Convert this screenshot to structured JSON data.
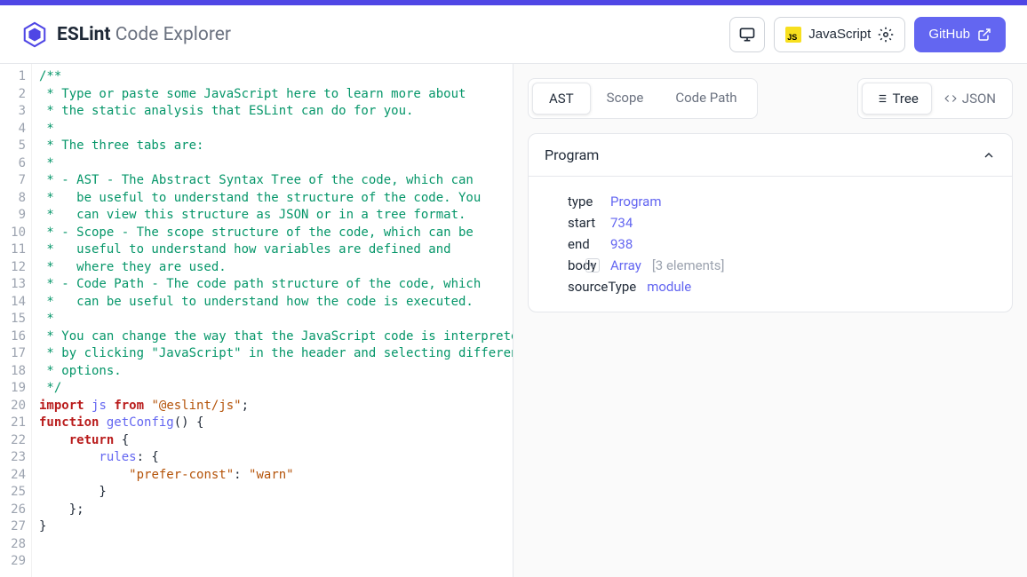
{
  "header": {
    "brand_bold": "ESLint",
    "brand_light": "Code Explorer",
    "language_label": "JavaScript",
    "github_label": "GitHub"
  },
  "editor": {
    "lines": [
      {
        "n": 1,
        "tokens": [
          {
            "t": "/**",
            "c": "c-comment"
          }
        ]
      },
      {
        "n": 2,
        "tokens": [
          {
            "t": " * Type or paste some JavaScript here to learn more about",
            "c": "c-comment"
          }
        ]
      },
      {
        "n": 3,
        "tokens": [
          {
            "t": " * the static analysis that ESLint can do for you.",
            "c": "c-comment"
          }
        ]
      },
      {
        "n": 4,
        "tokens": [
          {
            "t": " *",
            "c": "c-comment"
          }
        ]
      },
      {
        "n": 5,
        "tokens": [
          {
            "t": " * The three tabs are:",
            "c": "c-comment"
          }
        ]
      },
      {
        "n": 6,
        "tokens": [
          {
            "t": " *",
            "c": "c-comment"
          }
        ]
      },
      {
        "n": 7,
        "tokens": [
          {
            "t": " * - AST - The Abstract Syntax Tree of the code, which can",
            "c": "c-comment"
          }
        ]
      },
      {
        "n": 8,
        "tokens": [
          {
            "t": " *   be useful to understand the structure of the code. You",
            "c": "c-comment"
          }
        ]
      },
      {
        "n": 9,
        "tokens": [
          {
            "t": " *   can view this structure as JSON or in a tree format.",
            "c": "c-comment"
          }
        ]
      },
      {
        "n": 10,
        "tokens": [
          {
            "t": " * - Scope - The scope structure of the code, which can be",
            "c": "c-comment"
          }
        ]
      },
      {
        "n": 11,
        "tokens": [
          {
            "t": " *   useful to understand how variables are defined and",
            "c": "c-comment"
          }
        ]
      },
      {
        "n": 12,
        "tokens": [
          {
            "t": " *   where they are used.",
            "c": "c-comment"
          }
        ]
      },
      {
        "n": 13,
        "tokens": [
          {
            "t": " * - Code Path - The code path structure of the code, which",
            "c": "c-comment"
          }
        ]
      },
      {
        "n": 14,
        "tokens": [
          {
            "t": " *   can be useful to understand how the code is executed.",
            "c": "c-comment"
          }
        ]
      },
      {
        "n": 15,
        "tokens": [
          {
            "t": " *",
            "c": "c-comment"
          }
        ]
      },
      {
        "n": 16,
        "tokens": [
          {
            "t": " * You can change the way that the JavaScript code is interpreted",
            "c": "c-comment"
          }
        ]
      },
      {
        "n": 17,
        "tokens": [
          {
            "t": " * by clicking \"JavaScript\" in the header and selecting different",
            "c": "c-comment"
          }
        ]
      },
      {
        "n": 18,
        "tokens": [
          {
            "t": " * options.",
            "c": "c-comment"
          }
        ]
      },
      {
        "n": 19,
        "tokens": [
          {
            "t": " */",
            "c": "c-comment"
          }
        ]
      },
      {
        "n": 20,
        "tokens": [
          {
            "t": "",
            "c": ""
          }
        ]
      },
      {
        "n": 21,
        "tokens": [
          {
            "t": "import",
            "c": "c-keyword"
          },
          {
            "t": " ",
            "c": ""
          },
          {
            "t": "js",
            "c": "c-ident"
          },
          {
            "t": " ",
            "c": ""
          },
          {
            "t": "from",
            "c": "c-keyword"
          },
          {
            "t": " ",
            "c": ""
          },
          {
            "t": "\"@eslint/js\"",
            "c": "c-string"
          },
          {
            "t": ";",
            "c": "c-punct"
          }
        ]
      },
      {
        "n": 22,
        "tokens": [
          {
            "t": "",
            "c": ""
          }
        ]
      },
      {
        "n": 23,
        "tokens": [
          {
            "t": "function",
            "c": "c-keyword"
          },
          {
            "t": " ",
            "c": ""
          },
          {
            "t": "getConfig",
            "c": "c-ident"
          },
          {
            "t": "()",
            "c": "c-punct"
          },
          {
            "t": " {",
            "c": "c-punct"
          }
        ]
      },
      {
        "n": 24,
        "tokens": [
          {
            "t": "    ",
            "c": ""
          },
          {
            "t": "return",
            "c": "c-keyword"
          },
          {
            "t": " {",
            "c": "c-punct"
          }
        ]
      },
      {
        "n": 25,
        "tokens": [
          {
            "t": "        rules",
            "c": "c-ident"
          },
          {
            "t": ": {",
            "c": "c-punct"
          }
        ]
      },
      {
        "n": 26,
        "tokens": [
          {
            "t": "            ",
            "c": ""
          },
          {
            "t": "\"prefer-const\"",
            "c": "c-string"
          },
          {
            "t": ": ",
            "c": "c-punct"
          },
          {
            "t": "\"warn\"",
            "c": "c-string"
          }
        ]
      },
      {
        "n": 27,
        "tokens": [
          {
            "t": "        }",
            "c": "c-punct"
          }
        ]
      },
      {
        "n": 28,
        "tokens": [
          {
            "t": "    };",
            "c": "c-punct"
          }
        ]
      },
      {
        "n": 29,
        "tokens": [
          {
            "t": "}",
            "c": "c-punct"
          }
        ]
      }
    ]
  },
  "tabs": {
    "items": [
      "AST",
      "Scope",
      "Code Path"
    ],
    "active": "AST"
  },
  "viewToggle": {
    "items": [
      "Tree",
      "JSON"
    ],
    "active": "Tree"
  },
  "ast": {
    "title": "Program",
    "props": [
      {
        "key": "type",
        "value": "Program",
        "cls": "prop-val"
      },
      {
        "key": "start",
        "value": "734",
        "cls": "prop-val"
      },
      {
        "key": "end",
        "value": "938",
        "cls": "prop-val"
      },
      {
        "key": "body",
        "value": "Array",
        "cls": "prop-val",
        "suffix": "[3 elements]",
        "expandable": true
      },
      {
        "key": "sourceType",
        "value": "module",
        "cls": "prop-val"
      }
    ]
  }
}
